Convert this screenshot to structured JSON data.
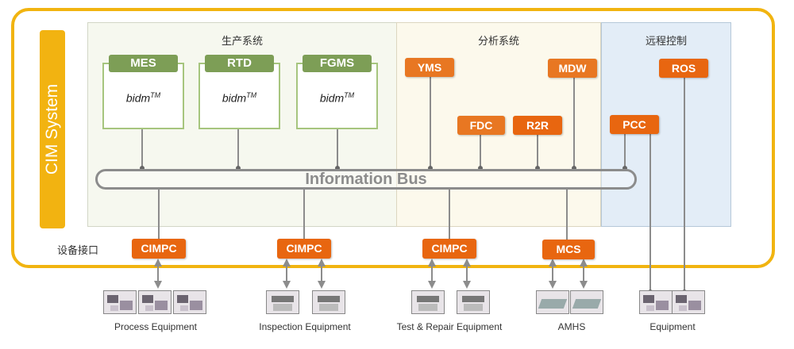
{
  "cim": {
    "title": "CIM System"
  },
  "panels": {
    "production": {
      "title": "生产系统"
    },
    "analysis": {
      "title": "分析系统"
    },
    "remote": {
      "title": "远程控制"
    }
  },
  "production_systems": [
    {
      "label": "MES",
      "sub": "bidm",
      "sup": "TM"
    },
    {
      "label": "RTD",
      "sub": "bidm",
      "sup": "TM"
    },
    {
      "label": "FGMS",
      "sub": "bidm",
      "sup": "TM"
    }
  ],
  "analysis_systems": {
    "yms": "YMS",
    "fdc": "FDC",
    "r2r": "R2R",
    "mdw": "MDW"
  },
  "remote_systems": {
    "pcc": "PCC",
    "ros": "ROS"
  },
  "bus": {
    "label": "Information Bus"
  },
  "interface": {
    "label": "设备接口",
    "units": [
      "CIMPC",
      "CIMPC",
      "CIMPC",
      "MCS"
    ]
  },
  "equipment_groups": [
    {
      "label": "Process Equipment"
    },
    {
      "label": "Inspection Equipment"
    },
    {
      "label": "Test & Repair Equipment"
    },
    {
      "label": "AMHS"
    },
    {
      "label": "Equipment"
    }
  ],
  "colors": {
    "frame": "#f1b410",
    "green_header": "#7d9e56",
    "green_border": "#a6c57e",
    "orange": "#e87722",
    "dark_orange": "#e86610",
    "bus": "#8c8c8c"
  }
}
